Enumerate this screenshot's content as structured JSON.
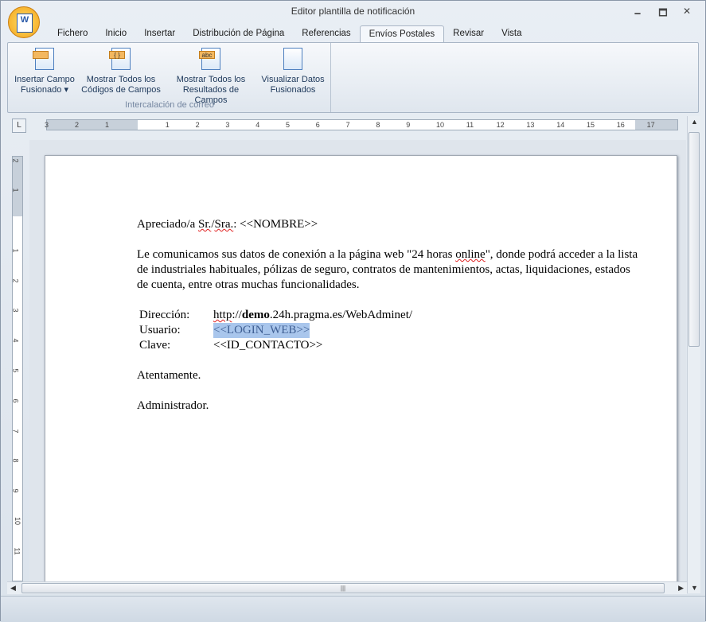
{
  "window": {
    "title": "Editor plantilla de notificación",
    "logo_text": "W"
  },
  "controls": {
    "minimize": "🗕",
    "maximize": "🗖",
    "close": "✕"
  },
  "tabs": [
    {
      "label": "Fichero"
    },
    {
      "label": "Inicio"
    },
    {
      "label": "Insertar"
    },
    {
      "label": "Distribución de Página"
    },
    {
      "label": "Referencias"
    },
    {
      "label": "Envíos Postales",
      "active": true
    },
    {
      "label": "Revisar"
    },
    {
      "label": "Vista"
    }
  ],
  "ribbon": {
    "group_label": "Intercalación de correo",
    "buttons": [
      {
        "line1": "Insertar Campo",
        "line2": "Fusionado ▾",
        "icon": "insert-merge-field-icon",
        "badge": ""
      },
      {
        "line1": "Mostrar Todos los",
        "line2": "Códigos de Campos",
        "icon": "field-codes-icon",
        "badge": "{ }"
      },
      {
        "line1": "Mostrar Todos los",
        "line2": "Resultados de Campos",
        "icon": "field-results-icon",
        "badge": "abc"
      },
      {
        "line1": "Visualizar Datos",
        "line2": "Fusionados",
        "icon": "preview-merged-icon",
        "badge": ""
      }
    ]
  },
  "ruler": {
    "tab_selector": "L",
    "h_labels": [
      "3",
      "2",
      "1",
      "1",
      "2",
      "3",
      "4",
      "5",
      "6",
      "7",
      "8",
      "9",
      "10",
      "11",
      "12",
      "13",
      "14",
      "15",
      "16",
      "17"
    ],
    "v_labels": [
      "2",
      "1",
      "1",
      "2",
      "3",
      "4",
      "5",
      "6",
      "7",
      "8",
      "9",
      "10",
      "11"
    ]
  },
  "document": {
    "greeting_prefix": "Apreciado/a ",
    "greeting_sr": "Sr.",
    "greeting_slash": "/",
    "greeting_sra": "Sra.",
    ":": "",
    "greeting_suffix": ": <<NOMBRE>>",
    "body_1": "Le comunicamos sus datos de conexión a la página web \"24 horas ",
    "body_online": "online",
    "body_2": "\", donde podrá acceder a la lista de industriales habituales, pólizas de seguro, contratos de mantenimientos, actas, liquidaciones, estados de cuenta, entre otras muchas funcionalidades.",
    "fields": {
      "direccion_label": "Dirección:",
      "direccion_http": "http",
      "direccion_sep": "://",
      "direccion_bold": "demo",
      "direccion_rest": ".24h.pragma.es/WebAdminet/",
      "usuario_label": "Usuario:",
      "usuario_value": "<<LOGIN_WEB>>",
      "clave_label": "Clave:",
      "clave_value": "<<ID_CONTACTO>>"
    },
    "closing": "Atentamente.",
    "signature": "Administrador."
  },
  "scroll": {
    "grip": "|||"
  }
}
